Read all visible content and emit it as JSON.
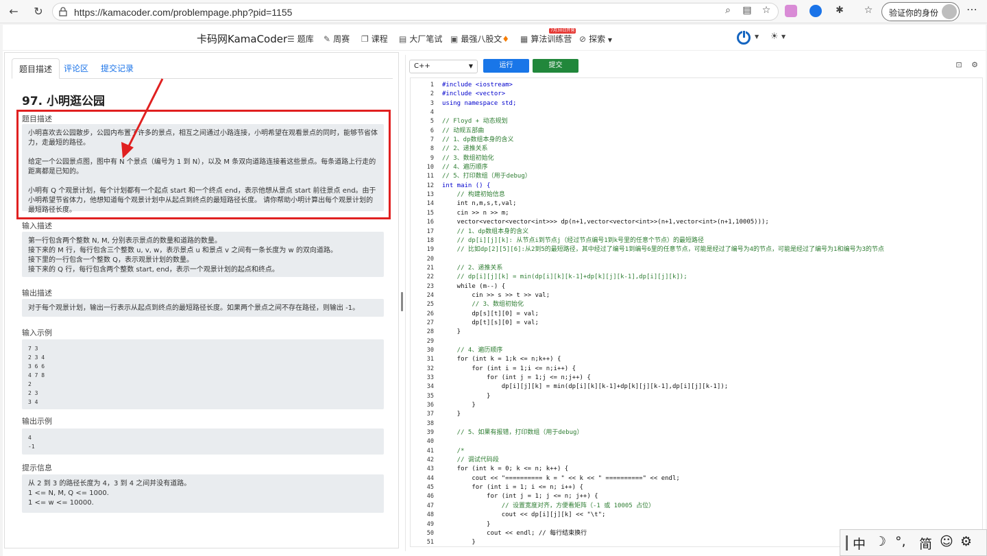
{
  "browser": {
    "url": "https://kamacoder.com/problempage.php?pid=1155",
    "verify_label": "验证你的身份"
  },
  "site": {
    "brand": "卡码网KamaCoder",
    "nav": [
      "题库",
      "周赛",
      "课程",
      "大厂笔试",
      "最强八股文",
      "算法训练营",
      "探索"
    ],
    "badge": "7月30日开营"
  },
  "problem": {
    "tabs": [
      "题目描述",
      "评论区",
      "提交记录"
    ],
    "title": "97. 小明逛公园",
    "desc_label": "题目描述",
    "desc": [
      "小明喜欢去公园散步，公园内布置了许多的景点，相互之间通过小路连接，小明希望在观看景点的同时，能够节省体力，走最短的路径。",
      "给定一个公园景点图，图中有 N 个景点（编号为 1 到 N），以及 M 条双向道路连接着这些景点。每条道路上行走的距离都是已知的。",
      "小明有 Q 个观景计划，每个计划都有一个起点 start 和一个终点 end，表示他想从景点 start 前往景点 end。由于小明希望节省体力，他想知道每个观景计划中从起点到终点的最短路径长度。 请你帮助小明计算出每个观景计划的最短路径长度。"
    ],
    "input_label": "输入描述",
    "input": [
      "第一行包含两个整数 N, M, 分别表示景点的数量和道路的数量。",
      "接下来的 M 行，每行包含三个整数 u, v, w，表示景点 u 和景点 v 之间有一条长度为 w 的双向道路。",
      "接下里的一行包含一个整数 Q，表示观景计划的数量。",
      "接下来的 Q 行，每行包含两个整数 start, end，表示一个观景计划的起点和终点。"
    ],
    "output_label": "输出描述",
    "output": "对于每个观景计划，输出一行表示从起点到终点的最短路径长度。如果两个景点之间不存在路径，则输出 -1。",
    "sample_in_label": "输入示例",
    "sample_in": [
      "7 3",
      "2 3 4",
      "3 6 6",
      "4 7 8",
      "2",
      "2 3",
      "3 4"
    ],
    "sample_out_label": "输出示例",
    "sample_out": [
      "4",
      "-1"
    ],
    "hint_label": "提示信息",
    "hint": [
      "从 2 到 3 的路径长度为 4，3 到 4 之间并没有道路。",
      "1 <= N, M, Q <= 1000.",
      "1 <= w <= 10000."
    ]
  },
  "editor": {
    "language": "C++",
    "run_label": "运行",
    "submit_label": "提交",
    "code": [
      "#include <iostream>",
      "#include <vector>",
      "using namespace std;",
      "",
      "// Floyd + 动态规划",
      "// 动规五部曲",
      "// 1、dp数组本身的含义",
      "// 2、递推关系",
      "// 3、数组初始化",
      "// 4、遍历顺序",
      "// 5、打印数组（用于debug）",
      "int main () {",
      "    // 构建初始信息",
      "    int n,m,s,t,val;",
      "    cin >> n >> m;",
      "    vector<vector<vector<int>>> dp(n+1,vector<vector<int>>(n+1,vector<int>(n+1,10005)));",
      "    // 1、dp数组本身的含义",
      "    // dp[i][j][k]: 从节点i到节点j（经过节点编号1到k号里的任意个节点）的最短路径",
      "    // 比如dp[2][5][6]:从2到5的最短路径，其中经过了编号1到编号6里的任意节点，可能是经过了编号为4的节点，可能是经过了编号为1和编号为3的节点",
      "",
      "    // 2、递推关系",
      "    // dp[i][j][k] = min(dp[i][k][k-1]+dp[k][j][k-1],dp[i][j][k]);",
      "    while (m--) {",
      "        cin >> s >> t >> val;",
      "        // 3、数组初始化",
      "        dp[s][t][0] = val;",
      "        dp[t][s][0] = val;",
      "    }",
      "",
      "    // 4、遍历顺序",
      "    for (int k = 1;k <= n;k++) {",
      "        for (int i = 1;i <= n;i++) {",
      "            for (int j = 1;j <= n;j++) {",
      "                dp[i][j][k] = min(dp[i][k][k-1]+dp[k][j][k-1],dp[i][j][k-1]);",
      "            }",
      "        }",
      "    }",
      "",
      "    // 5、如果有报错，打印数组（用于debug）",
      "",
      "    /*",
      "    // 调试代码段",
      "    for (int k = 0; k <= n; k++) {",
      "        cout << \"========== k = \" << k << \" ==========\" << endl;",
      "        for (int i = 1; i <= n; i++) {",
      "            for (int j = 1; j <= n; j++) {",
      "                // 设置宽度对齐，方便看矩阵（-1 或 10005 占位）",
      "                cout << dp[i][j][k] << \"\\t\";",
      "            }",
      "            cout << endl; // 每行结束换行",
      "        }"
    ]
  },
  "ime": [
    "中",
    "☽",
    "°,",
    "简",
    "☺",
    "⚙"
  ]
}
